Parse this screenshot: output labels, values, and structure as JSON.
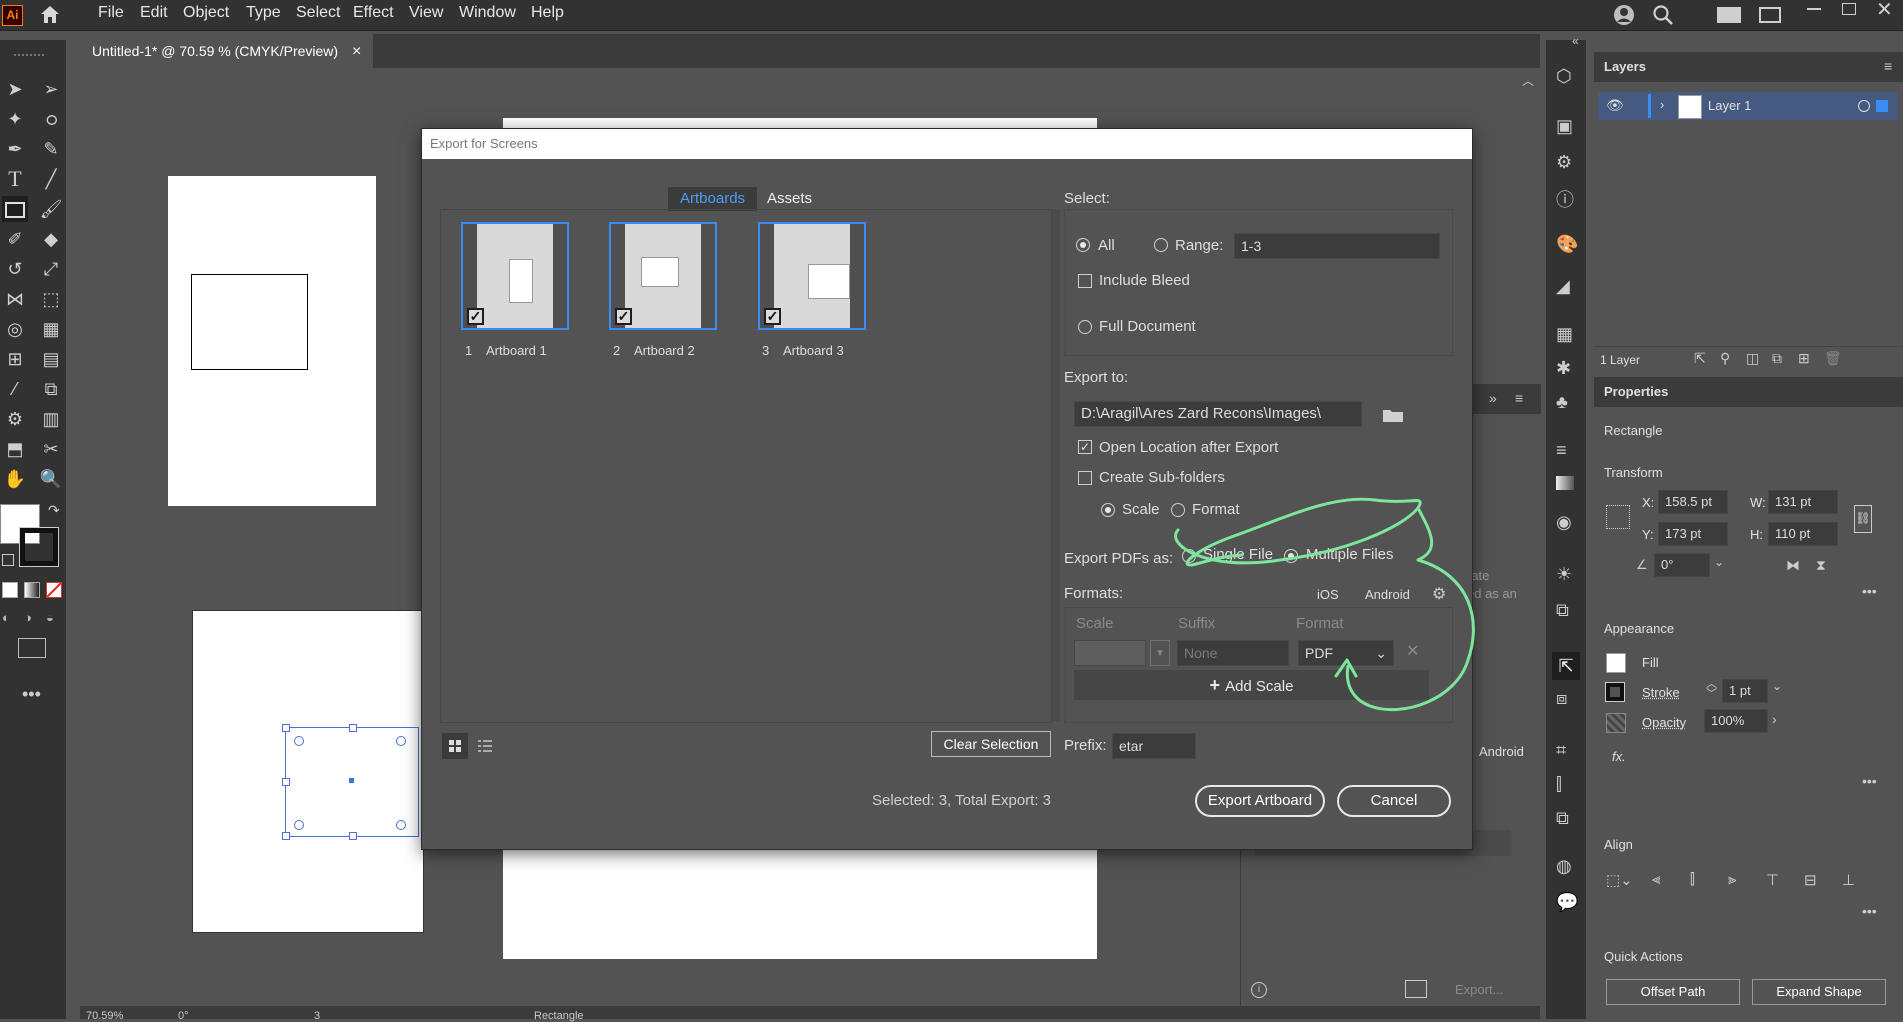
{
  "app": {
    "logo_text": "Ai"
  },
  "menu": [
    "File",
    "Edit",
    "Object",
    "Type",
    "Select",
    "Effect",
    "View",
    "Window",
    "Help"
  ],
  "document_tab": {
    "title": "Untitled-1* @ 70.59 % (CMYK/Preview)",
    "close": "×"
  },
  "dialog": {
    "title": "Export for Screens",
    "tabs": [
      "Artboards",
      "Assets"
    ],
    "artboards": [
      {
        "num": "1",
        "name": "Artboard 1"
      },
      {
        "num": "2",
        "name": "Artboard 2"
      },
      {
        "num": "3",
        "name": "Artboard 3"
      }
    ],
    "clear_selection": "Clear Selection",
    "select": {
      "label": "Select:",
      "all": "All",
      "range": "Range:",
      "range_value": "1-3",
      "include_bleed": "Include Bleed",
      "full_document": "Full Document"
    },
    "export_to": {
      "label": "Export to:",
      "path": "D:\\Aragil\\Ares Zard Recons\\Images\\",
      "open_location": "Open Location after Export",
      "create_subfolders": "Create Sub-folders",
      "scale": "Scale",
      "format": "Format"
    },
    "export_pdfs": {
      "label": "Export PDFs as:",
      "single": "Single File",
      "multiple": "Multiple Files"
    },
    "formats": {
      "label": "Formats:",
      "ios": "iOS",
      "android": "Android",
      "col_scale": "Scale",
      "col_suffix": "Suffix",
      "col_format": "Format",
      "suffix_placeholder": "None",
      "format_value": "PDF",
      "add_scale": "Add Scale"
    },
    "prefix": {
      "label": "Prefix:",
      "value": "etar"
    },
    "status": "Selected: 3, Total Export: 3",
    "export_button": "Export Artboard",
    "cancel_button": "Cancel"
  },
  "layers_panel": {
    "title": "Layers",
    "layer_name": "Layer 1",
    "footer": "1 Layer"
  },
  "properties_panel": {
    "title": "Properties",
    "object": "Rectangle",
    "transform": "Transform",
    "x_label": "X:",
    "x": "158.5 pt",
    "y_label": "Y:",
    "y": "173 pt",
    "w_label": "W:",
    "w": "131 pt",
    "h_label": "H:",
    "h": "110 pt",
    "angle": "0°",
    "appearance": "Appearance",
    "fill": "Fill",
    "stroke": "Stroke",
    "stroke_value": "1 pt",
    "opacity": "Opacity",
    "opacity_value": "100%",
    "fx": "fx.",
    "align": "Align",
    "quick_actions": "Quick Actions",
    "offset_path": "Offset Path",
    "expand_shape": "Expand Shape"
  },
  "background_panel": {
    "android": "Android",
    "text_fragment_1": "rate",
    "text_fragment_2": "ed as an",
    "export": "Export..."
  },
  "status_bar": {
    "zoom": "70.59%",
    "angle": "0°",
    "page": "3",
    "tool": "Rectangle"
  },
  "colors": {
    "annotation": "#7ee69a",
    "accent": "#3b8cf5",
    "selection": "#4b6fd6"
  }
}
